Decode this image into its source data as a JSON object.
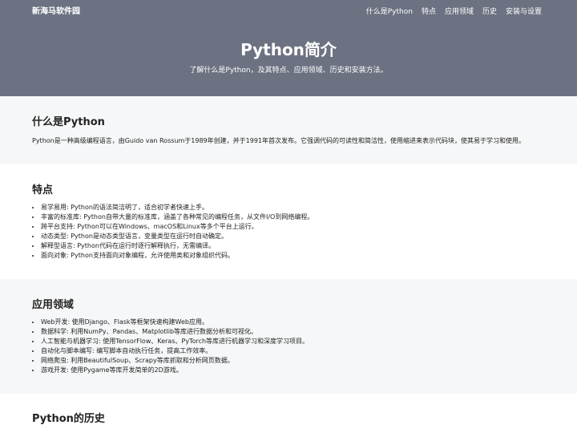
{
  "site": {
    "brand": "新海马软件园"
  },
  "nav": {
    "items": [
      "什么是Python",
      "特点",
      "应用领域",
      "历史",
      "安装与设置"
    ]
  },
  "hero": {
    "title": "Python简介",
    "subtitle": "了解什么是Python，及其特点、应用领域、历史和安装方法。"
  },
  "sections": {
    "about": {
      "title": "什么是Python",
      "text": "Python是一种高级编程语言，由Guido van Rossum于1989年创建，并于1991年首次发布。它强调代码的可读性和简洁性，使用缩进来表示代码块，使其易于学习和使用。"
    },
    "features": {
      "title": "特点",
      "items": [
        "易学易用: Python的语法简洁明了，适合初学者快速上手。",
        "丰富的标准库: Python自带大量的标准库，涵盖了各种常见的编程任务，从文件I/O到网络编程。",
        "跨平台支持: Python可以在Windows、macOS和Linux等多个平台上运行。",
        "动态类型: Python是动态类型语言，变量类型在运行时自动确定。",
        "解释型语言: Python代码在运行时逐行解释执行，无需编译。",
        "面向对象: Python支持面向对象编程，允许使用类和对象组织代码。"
      ]
    },
    "applications": {
      "title": "应用领域",
      "items": [
        "Web开发: 使用Django、Flask等框架快速构建Web应用。",
        "数据科学: 利用NumPy、Pandas、Matplotlib等库进行数据分析和可视化。",
        "人工智能与机器学习: 使用TensorFlow、Keras、PyTorch等库进行机器学习和深度学习项目。",
        "自动化与脚本编写: 编写脚本自动执行任务，提高工作效率。",
        "网络爬虫: 利用BeautifulSoup、Scrapy等库抓取和分析网页数据。",
        "游戏开发: 使用Pygame等库开发简单的2D游戏。"
      ]
    },
    "history": {
      "title": "Python的历史"
    }
  }
}
